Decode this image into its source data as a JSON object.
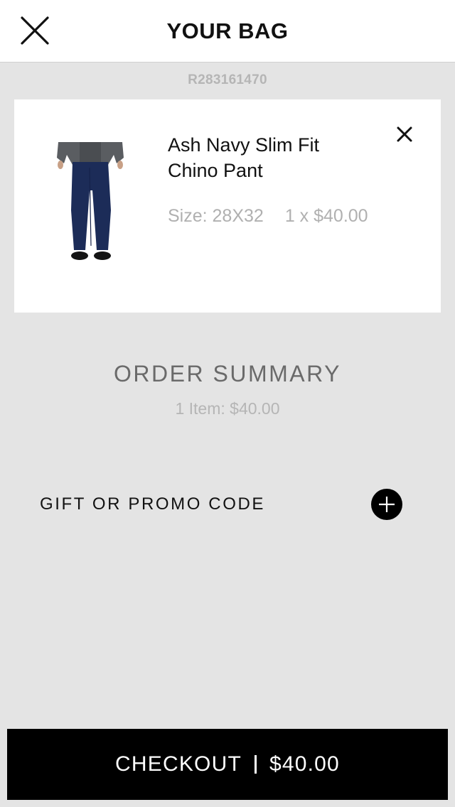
{
  "header": {
    "title": "YOUR BAG",
    "close_icon": "close-icon"
  },
  "order": {
    "number": "R283161470"
  },
  "cart_items": [
    {
      "name": "Ash Navy Slim Fit Chino Pant",
      "size_label": "Size: 28X32",
      "quantity_price": "1 x $40.00",
      "image_icon": "product-photo-navy-chino",
      "remove_icon": "remove-icon"
    }
  ],
  "summary": {
    "title": "ORDER SUMMARY",
    "items_text": "1 Item: $40.00"
  },
  "promo": {
    "label": "GIFT OR PROMO CODE",
    "icon": "plus-circle-icon"
  },
  "checkout": {
    "label": "CHECKOUT",
    "total": "$40.00"
  },
  "colors": {
    "background": "#e4e4e4",
    "header_bg": "#ffffff",
    "card_bg": "#ffffff",
    "checkout_bg": "#000000",
    "muted_text": "#b5b5b5"
  }
}
